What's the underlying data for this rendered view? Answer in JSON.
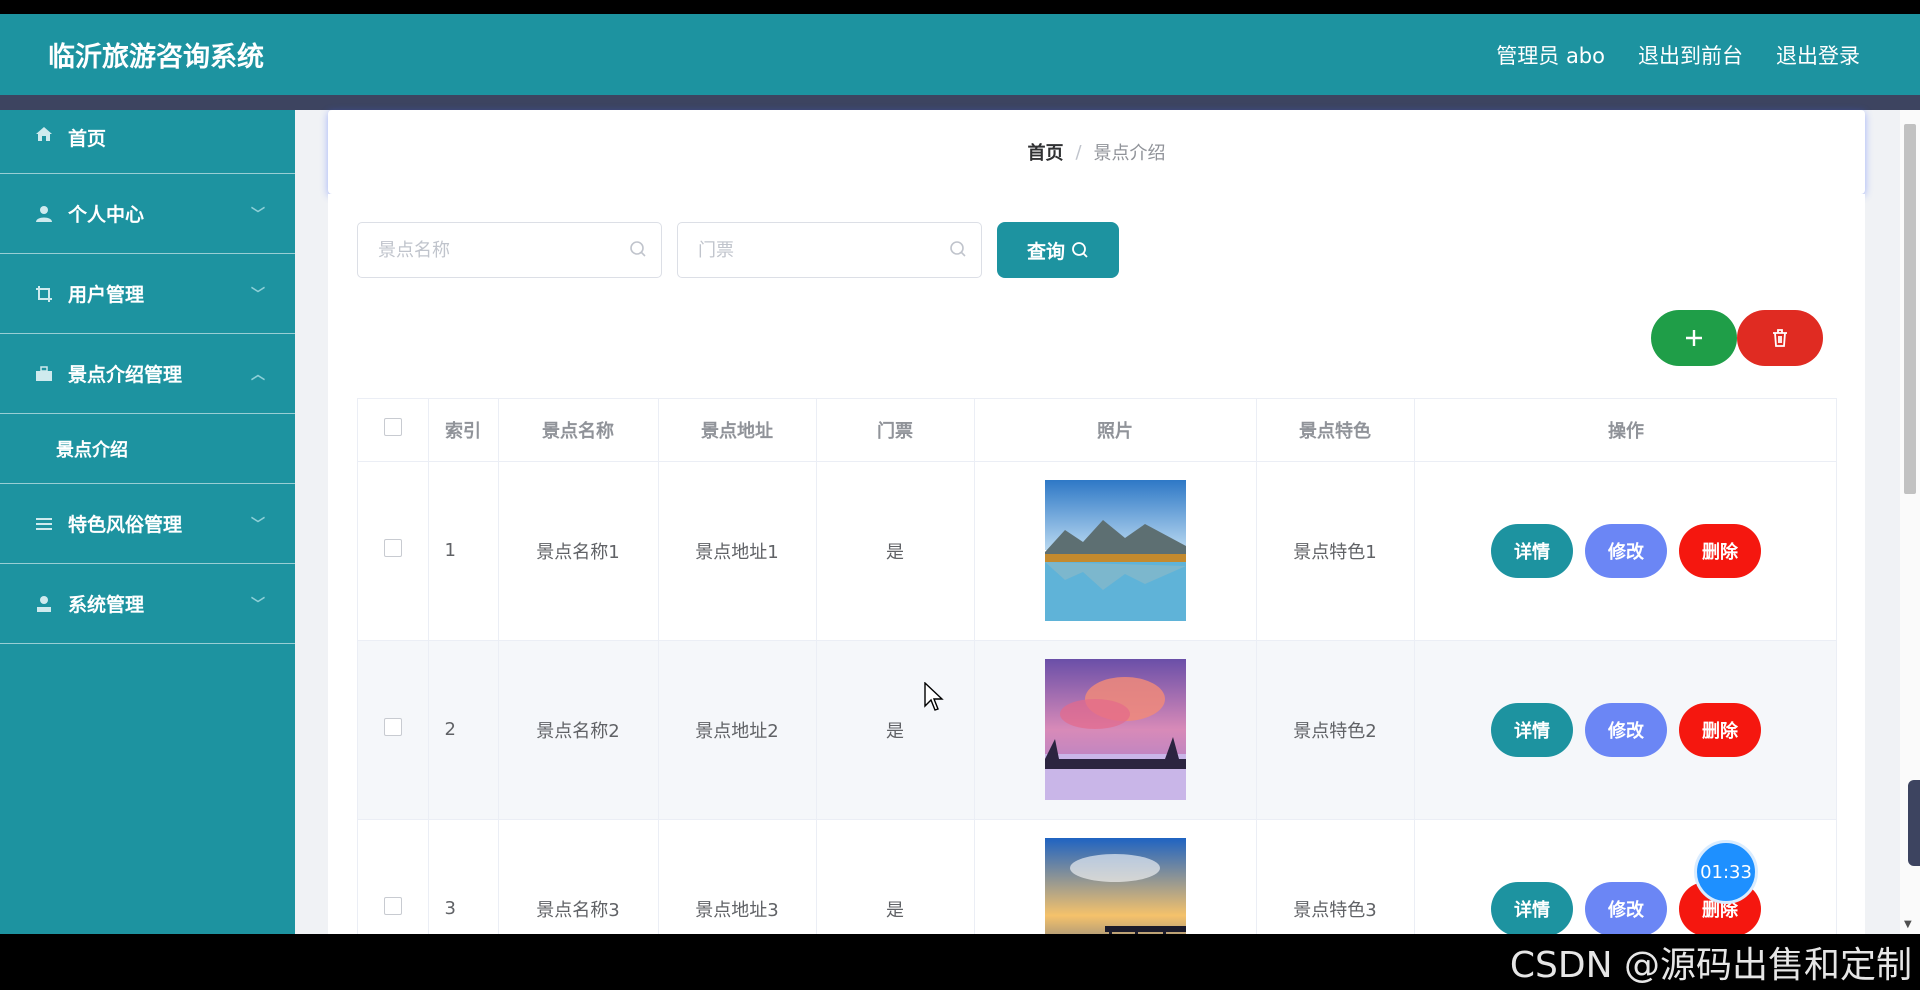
{
  "header": {
    "app_title": "临沂旅游咨询系统",
    "user_label": "管理员 abo",
    "to_front_label": "退出到前台",
    "logout_label": "退出登录"
  },
  "sidebar": {
    "items": [
      {
        "label": "首页",
        "icon": "home-icon"
      },
      {
        "label": "个人中心",
        "icon": "user-icon",
        "arrow": "chevron-down-icon"
      },
      {
        "label": "用户管理",
        "icon": "crop-icon",
        "arrow": "chevron-down-icon"
      },
      {
        "label": "景点介绍管理",
        "icon": "briefcase-icon",
        "arrow": "chevron-up-icon"
      },
      {
        "label": "特色风俗管理",
        "icon": "list-icon",
        "arrow": "chevron-down-icon"
      },
      {
        "label": "系统管理",
        "icon": "user-admin-icon",
        "arrow": "chevron-down-icon"
      }
    ],
    "submenu": {
      "label": "景点介绍"
    }
  },
  "breadcrumb": {
    "home": "首页",
    "separator": "/",
    "current": "景点介绍"
  },
  "search": {
    "name_placeholder": "景点名称",
    "ticket_placeholder": "门票",
    "query_label": "查询"
  },
  "table": {
    "columns": [
      "索引",
      "景点名称",
      "景点地址",
      "门票",
      "照片",
      "景点特色",
      "操作"
    ],
    "rows": [
      {
        "index": "1",
        "name": "景点名称1",
        "address": "景点地址1",
        "ticket": "是",
        "feature": "景点特色1"
      },
      {
        "index": "2",
        "name": "景点名称2",
        "address": "景点地址2",
        "ticket": "是",
        "feature": "景点特色2"
      },
      {
        "index": "3",
        "name": "景点名称3",
        "address": "景点地址3",
        "ticket": "是",
        "feature": "景点特色3"
      }
    ],
    "actions": {
      "detail": "详情",
      "edit": "修改",
      "delete": "删除"
    }
  },
  "timer": "01:33",
  "watermark": "CSDN @源码出售和定制",
  "colors": {
    "primary": "#1d93a0",
    "header_strip": "#3d4460",
    "add": "#1f9e48",
    "delete": "#e02b22",
    "edit": "#6b86f5"
  }
}
